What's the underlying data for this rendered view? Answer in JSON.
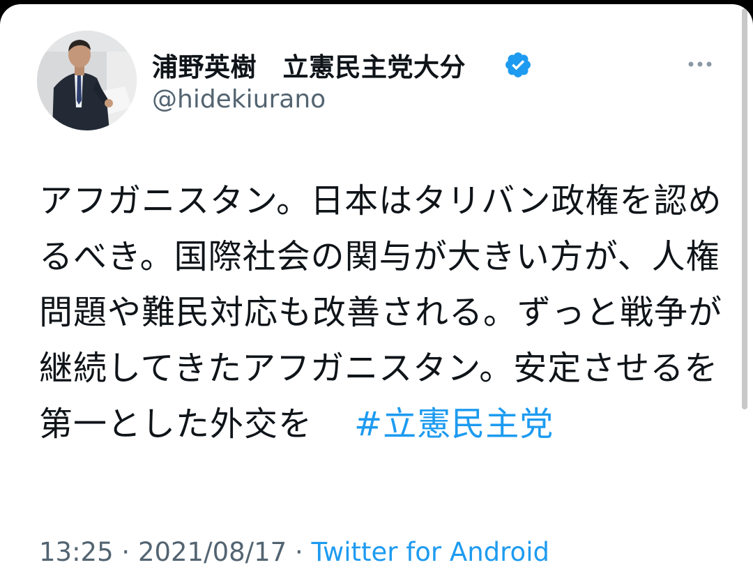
{
  "tweet": {
    "display_name": "浦野英樹　立憲民主党大分",
    "handle": "@hidekiurano",
    "body_text": "アフガニスタン。日本はタリバン政権を認めるべき。国際社会の関与が大きい方が、人権問題や難民対応も改善される。ずっと戦争が継続してきたアフガニスタン。安定させるを第一とした外交を",
    "hashtag": "#立憲民主党",
    "time": "13:25",
    "separator": "·",
    "date": "2021/08/17",
    "source": "Twitter for Android"
  },
  "icons": {
    "verified": "verified-badge-icon",
    "more": "more-options-icon"
  },
  "colors": {
    "accent": "#1d9bf0",
    "text_primary": "#0f1419",
    "text_secondary": "#536471"
  }
}
